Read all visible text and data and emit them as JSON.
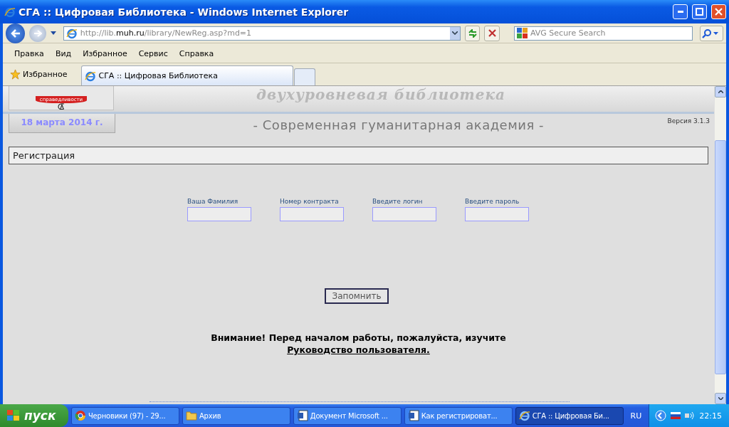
{
  "window": {
    "title": "СГА :: Цифровая Библиотека - Windows Internet Explorer"
  },
  "address_bar": {
    "url_prefix": "http://lib.",
    "url_domain": "muh.ru",
    "url_path": "/library/NewReg.asp?md=1"
  },
  "search": {
    "placeholder": "AVG Secure Search"
  },
  "menu": [
    "Правка",
    "Вид",
    "Избранное",
    "Сервис",
    "Справка"
  ],
  "favorites": {
    "label": "Избранное"
  },
  "tabs": [
    {
      "label": "СГА :: Цифровая Библиотека",
      "selected": true
    }
  ],
  "page": {
    "banner": "двухуровневая библиотека",
    "logo_text": "справедливости",
    "date": "18 марта 2014 г.",
    "subtitle": "- Современная гуманитарная академия -",
    "version": "Версия 3.1.3",
    "section_title": "Регистрация",
    "fields": [
      {
        "label": "Ваша Фамилия"
      },
      {
        "label": "Номер контракта"
      },
      {
        "label": "Введите логин"
      },
      {
        "label": "Введите пароль"
      }
    ],
    "submit": "Запомнить",
    "notice": "Внимание! Перед началом работы, пожалуйста, изучите",
    "notice_link": "Руководство пользователя."
  },
  "taskbar": {
    "start": "пуск",
    "items": [
      {
        "label": "Черновики (97) - 29...",
        "kind": "chrome",
        "selected": false
      },
      {
        "label": "Архив",
        "kind": "folder",
        "selected": false
      },
      {
        "label": "Документ Microsoft ...",
        "kind": "word",
        "selected": false
      },
      {
        "label": "Как регистрироват...",
        "kind": "word",
        "selected": false
      },
      {
        "label": "СГА :: Цифровая Би...",
        "kind": "ie",
        "selected": true
      }
    ],
    "language": "RU",
    "clock": "22:15"
  }
}
